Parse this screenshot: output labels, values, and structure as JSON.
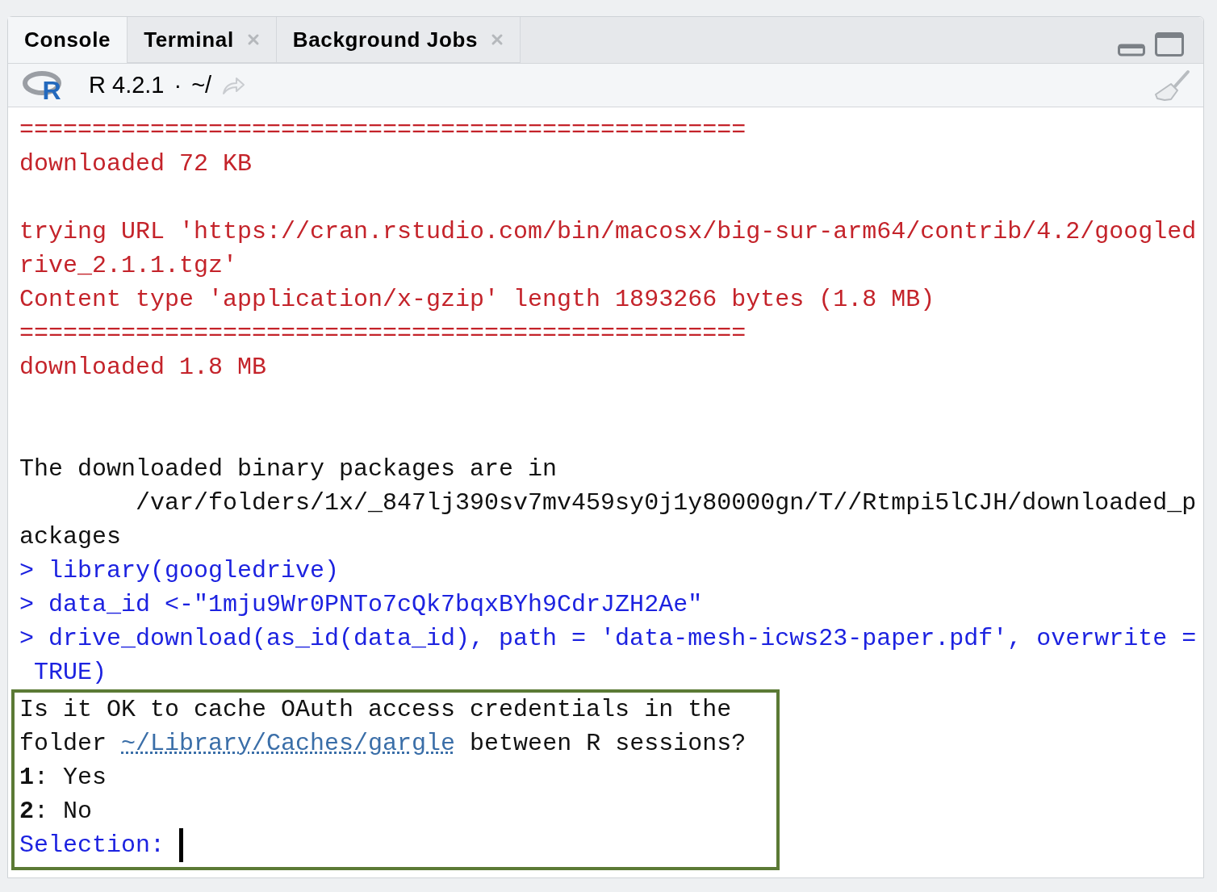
{
  "tabs": [
    {
      "label": "Console",
      "selected": true,
      "closable": false
    },
    {
      "label": "Terminal",
      "selected": false,
      "closable": true
    },
    {
      "label": "Background Jobs",
      "selected": false,
      "closable": true
    }
  ],
  "toolbar": {
    "logo_letter": "R",
    "version": "R 4.2.1",
    "separator": "·",
    "path": "~/"
  },
  "console": [
    {
      "kind": "output",
      "text": "=================================================="
    },
    {
      "kind": "output",
      "text": "downloaded 72 KB"
    },
    {
      "kind": "blank"
    },
    {
      "kind": "output",
      "text": "trying URL 'https://cran.rstudio.com/bin/macosx/big-sur-arm64/contrib/4.2/googled"
    },
    {
      "kind": "output",
      "text": "rive_2.1.1.tgz'"
    },
    {
      "kind": "output",
      "text": "Content type 'application/x-gzip' length 1893266 bytes (1.8 MB)"
    },
    {
      "kind": "output",
      "text": "=================================================="
    },
    {
      "kind": "output",
      "text": "downloaded 1.8 MB"
    },
    {
      "kind": "blank"
    },
    {
      "kind": "blank"
    },
    {
      "kind": "plain",
      "text": "The downloaded binary packages are in"
    },
    {
      "kind": "plain",
      "text": "        /var/folders/1x/_847lj390sv7mv459sy0j1y80000gn/T//Rtmpi5lCJH/downloaded_p"
    },
    {
      "kind": "plain",
      "text": "ackages"
    },
    {
      "kind": "input",
      "text": "> library(googledrive)"
    },
    {
      "kind": "input",
      "text": "> data_id <-\"1mju9Wr0PNTo7cQk7bqxBYh9CdrJZH2Ae\""
    },
    {
      "kind": "input",
      "text": "> drive_download(as_id(data_id), path = 'data-mesh-icws23-paper.pdf', overwrite ="
    },
    {
      "kind": "input",
      "text": " TRUE)"
    }
  ],
  "prompt_box": {
    "question_line": "Is it OK to cache OAuth access credentials in the",
    "folder_before": "folder ",
    "folder_link": "~/Library/Caches/gargle",
    "folder_after": " between R sessions?",
    "options": [
      "**1**: Yes",
      "**2**: No"
    ],
    "selection_label": "Selection:"
  }
}
